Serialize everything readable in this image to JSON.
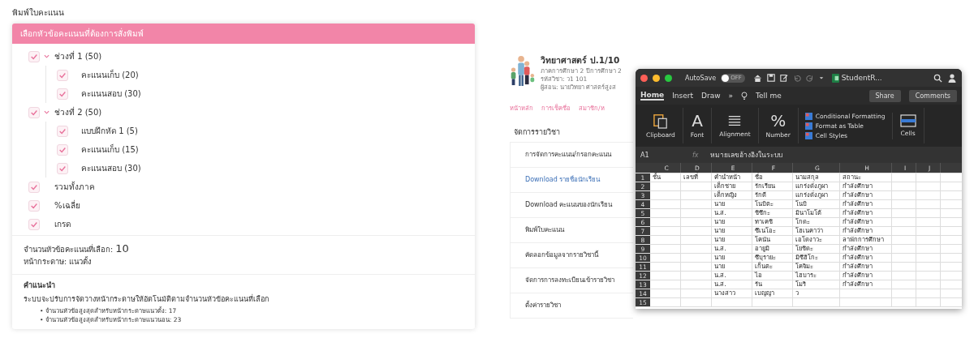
{
  "page_title": "พิมพ์ใบคะแนน",
  "print_panel": {
    "header": "เลือกหัวข้อคะแนนที่ต้องการสั่งพิมพ์",
    "tree": [
      {
        "label": "ช่วงที่ 1 (50)",
        "checked": true,
        "expanded": true,
        "children": [
          {
            "label": "คะแนนเก็บ (20)",
            "checked": true
          },
          {
            "label": "คะแนนสอบ (30)",
            "checked": true
          }
        ]
      },
      {
        "label": "ช่วงที่ 2 (50)",
        "checked": true,
        "expanded": true,
        "children": [
          {
            "label": "แบบฝึกหัด 1 (5)",
            "checked": true
          },
          {
            "label": "คะแนนเก็บ (15)",
            "checked": true
          },
          {
            "label": "คะแนนสอบ (30)",
            "checked": true
          }
        ]
      },
      {
        "label": "รวมทั้งภาค",
        "checked": true
      },
      {
        "label": "%เฉลี่ย",
        "checked": true
      },
      {
        "label": "เกรด",
        "checked": true
      }
    ],
    "selected_count_label": "จำนวนหัวข้อคะแนนที่เลือก:",
    "selected_count": "10",
    "orientation": "หน้ากระดาษ: แนวตั้ง",
    "advice_title": "คำแนะนำ",
    "advice_text": "ระบบจะปรับการจัดวางหน้ากระดาษให้อัตโนมัติตามจำนวนหัวข้อคะแนนที่เลือก",
    "bullet_marker": "•",
    "advice_bullets": [
      "จำนวนหัวข้อสูงสุดสำหรับหน้ากระดาษแนวตั้ง: 17",
      "จำนวนหัวข้อสูงสุดสำหรับหน้ากระดาษแนวนอน: 23"
    ]
  },
  "course": {
    "title": "วิทยาศาสตร์ ป.1/10",
    "details": [
      "ภาคการศึกษา 2 ปีการศึกษา 2",
      "รหัสวิชา: ว1 101",
      "ผู้สอน: นายวิทยา ศาสตร์สูงส"
    ],
    "nav": [
      "หน้าหลัก",
      "การเช็คชื่อ",
      "สมาชิก/ห"
    ],
    "section_title": "จัดการรายวิชา",
    "menu": [
      {
        "label": "การจัดการคะแนน/กรอกคะแนน",
        "selected": false
      },
      {
        "label": "Download รายชื่อนักเรียน",
        "selected": true
      },
      {
        "label": "Download คะแนนของนักเรียน",
        "selected": false
      },
      {
        "label": "พิมพ์ใบคะแนน",
        "selected": false
      },
      {
        "label": "คัดลอกข้อมูลจากรายวิชานี้",
        "selected": false
      },
      {
        "label": "จัดการการลงทะเบียนเข้ารายวิชา",
        "selected": false
      },
      {
        "label": "ตั้งค่ารายวิชา",
        "selected": false
      }
    ]
  },
  "excel": {
    "autosave_label": "AutoSave",
    "autosave": {
      "on": false,
      "label": "OFF"
    },
    "document": "StudentR...",
    "tabs": [
      {
        "label": "Home",
        "selected": true
      },
      {
        "label": "Insert",
        "selected": false
      },
      {
        "label": "Draw",
        "selected": false
      }
    ],
    "tab_overflow": "»",
    "tell_me": "Tell me",
    "share": "Share",
    "comments": "Comments",
    "ribbon": [
      {
        "kind": "clipboard",
        "label": "Clipboard"
      },
      {
        "kind": "font",
        "glyph": "A",
        "label": "Font"
      },
      {
        "kind": "alignment",
        "label": "Alignment"
      },
      {
        "kind": "number",
        "glyph": "%",
        "label": "Number"
      },
      {
        "kind": "styles",
        "items": [
          "Conditional Formatting",
          "Format as Table",
          "Cell Styles"
        ]
      },
      {
        "kind": "cells",
        "label": "Cells"
      }
    ],
    "cell_ref": "A1",
    "fx": "fx",
    "formula": "หมายเลขอ้างอิงในระบบ",
    "columns": [
      "C",
      "D",
      "E",
      "F",
      "G",
      "H",
      "I",
      "J"
    ],
    "rows": [
      {
        "row": "1",
        "C": "ชั้น",
        "D": "เลขที่",
        "E": "คำนำหน้า",
        "F": "ชื่อ",
        "G": "นามสกุล",
        "H": "สถานะ"
      },
      {
        "row": "2",
        "E": "เด็กชาย",
        "F": "รักเรียน",
        "G": "แกร่งดั่งภูผา",
        "H": "กำลังศึกษา"
      },
      {
        "row": "3",
        "E": "เด็กหญิง",
        "F": "รักดี",
        "G": "แกร่งดั่งภูผา",
        "H": "กำลังศึกษา"
      },
      {
        "row": "4",
        "E": "นาย",
        "F": "โนบิตะ",
        "G": "โนบิ",
        "H": "กำลังศึกษา"
      },
      {
        "row": "5",
        "E": "น.ส.",
        "F": "ชิซึกะ",
        "G": "มินาโมโต้",
        "H": "กำลังศึกษา"
      },
      {
        "row": "6",
        "E": "นาย",
        "F": "ทาเคชิ",
        "G": "โกดะ",
        "H": "กำลังศึกษา"
      },
      {
        "row": "7",
        "E": "นาย",
        "F": "ซึเนโอะ",
        "G": "โฮเนคาว่า",
        "H": "กำลังศึกษา"
      },
      {
        "row": "8",
        "E": "นาย",
        "F": "โคนัน",
        "G": "เอโดงาวะ",
        "H": "ลาพักการศึกษา"
      },
      {
        "row": "9",
        "E": "น.ส.",
        "F": "อายูมิ",
        "G": "โยชิดะ",
        "H": "กำลังศึกษา"
      },
      {
        "row": "10",
        "E": "นาย",
        "F": "ซึบุรายะ",
        "G": "มิซึฮิโกะ",
        "H": "กำลังศึกษา"
      },
      {
        "row": "11",
        "E": "นาย",
        "F": "เก็นตะ",
        "G": "โคจิมะ",
        "H": "กำลังศึกษา"
      },
      {
        "row": "12",
        "E": "น.ส.",
        "F": "ไอ",
        "G": "ไฮบาระ",
        "H": "กำลังศึกษา"
      },
      {
        "row": "13",
        "E": "น.ส.",
        "F": "รัน",
        "G": "โมริ",
        "H": "กำลังศึกษา"
      },
      {
        "row": "14",
        "E": "นางสาว",
        "F": "เบญญา",
        "G": "ว"
      },
      {
        "row": "15"
      }
    ]
  }
}
